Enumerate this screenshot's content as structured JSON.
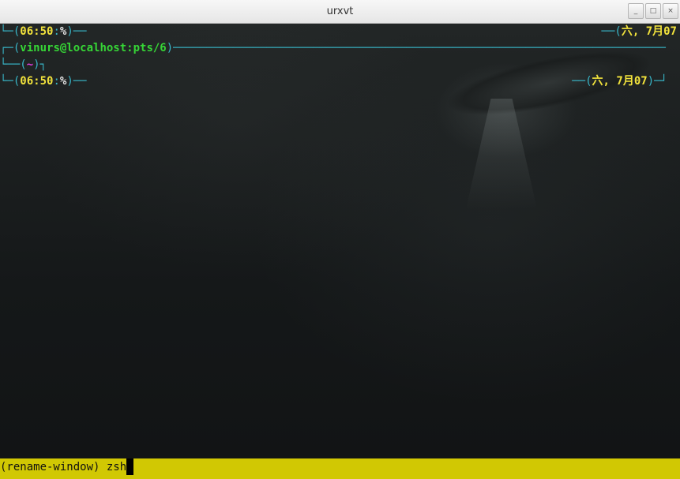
{
  "window": {
    "title": "urxvt",
    "buttons": [
      "_",
      "□",
      "×"
    ]
  },
  "terminal": {
    "line1": {
      "corner": "└─(",
      "time": "06:50",
      "sep": ":",
      "prompt": "%",
      "close": ")──",
      "right": {
        "open": "──(",
        "date": "六, 7月07",
        "close": ""
      }
    },
    "line2": {
      "corner": "┌─(",
      "userhost": "vinurs@localhost:pts/6",
      "close": ")──────────────────────────────────────────────────────────────────────────"
    },
    "line3": {
      "corner": "└──(",
      "dir": "~",
      "close": ")┐"
    },
    "line4": {
      "corner": "└─(",
      "time": "06:50",
      "sep": ":",
      "prompt": "%",
      "close": ")──",
      "right": {
        "open": "──(",
        "date": "六, 7月07",
        "close": ")─┘"
      }
    }
  },
  "status": {
    "text": "(rename-window) zsh"
  }
}
